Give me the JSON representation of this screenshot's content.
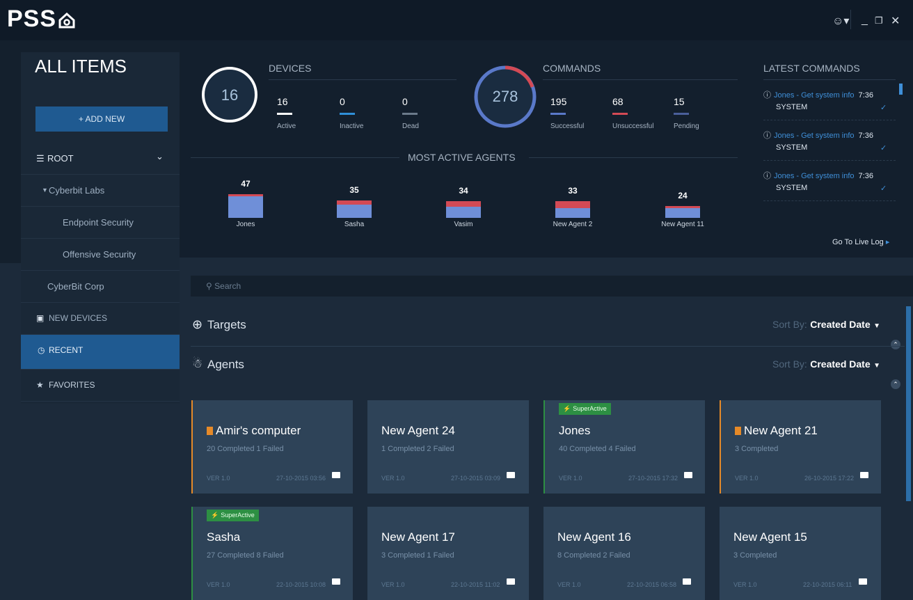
{
  "app": {
    "logo_text": "PSS"
  },
  "sidebar": {
    "title": "ALL ITEMS",
    "add_new": "+ ADD NEW",
    "root": "ROOT",
    "items": [
      {
        "label": "Cyberbit Labs"
      },
      {
        "label": "Endpoint Security"
      },
      {
        "label": "Offensive Security"
      },
      {
        "label": "CyberBit Corp"
      }
    ],
    "new_devices": "NEW DEVICES",
    "recent": "RECENT",
    "favorites": "FAVORITES"
  },
  "devices": {
    "title": "DEVICES",
    "total": "16",
    "stats": [
      {
        "value": "16",
        "label": "Active",
        "color": "#ffffff"
      },
      {
        "value": "0",
        "label": "Inactive",
        "color": "#2f8fd8"
      },
      {
        "value": "0",
        "label": "Dead",
        "color": "#6b7a8a"
      }
    ]
  },
  "commands": {
    "title": "COMMANDS",
    "total": "278",
    "stats": [
      {
        "value": "195",
        "label": "Successful",
        "color": "#5a79c9"
      },
      {
        "value": "68",
        "label": "Unsuccessful",
        "color": "#d34a55"
      },
      {
        "value": "15",
        "label": "Pending",
        "color": "#4a5f9a"
      }
    ]
  },
  "most_active": {
    "title": "MOST ACTIVE AGENTS",
    "agents": [
      {
        "name": "Jones",
        "count": "47",
        "count_n": 47,
        "failed": 4
      },
      {
        "name": "Sasha",
        "count": "35",
        "count_n": 35,
        "failed": 8
      },
      {
        "name": "Vasim",
        "count": "34",
        "count_n": 34,
        "failed": 12
      },
      {
        "name": "New Agent 2",
        "count": "33",
        "count_n": 33,
        "failed": 14
      },
      {
        "name": "New Agent 11",
        "count": "24",
        "count_n": 24,
        "failed": 3
      }
    ]
  },
  "latest_commands": {
    "title": "LATEST COMMANDS",
    "items": [
      {
        "text": "Jones - Get system info",
        "time": "7:36",
        "sub": "SYSTEM"
      },
      {
        "text": "Jones - Get system info",
        "time": "7:36",
        "sub": "SYSTEM"
      },
      {
        "text": "Jones - Get system info",
        "time": "7:36",
        "sub": "SYSTEM"
      }
    ],
    "go_live": "Go To Live Log"
  },
  "search": {
    "placeholder": "Search"
  },
  "sections": {
    "targets": {
      "title": "Targets",
      "sort_label": "Sort By:",
      "sort_value": "Created Date"
    },
    "agents": {
      "title": "Agents",
      "sort_label": "Sort By:",
      "sort_value": "Created Date"
    }
  },
  "cards": [
    {
      "name": "Amir's computer",
      "stat": "20 Completed 1 Failed",
      "ver": "VER 1.0",
      "date": "27-10-2015 03:56",
      "flag": true,
      "badge": ""
    },
    {
      "name": "New Agent 24",
      "stat": "1 Completed 2 Failed",
      "ver": "VER 1.0",
      "date": "27-10-2015 03:09",
      "flag": false,
      "badge": ""
    },
    {
      "name": "Jones",
      "stat": "40 Completed 4 Failed",
      "ver": "VER 1.0",
      "date": "27-10-2015 17:32",
      "flag": false,
      "badge": "SuperActive"
    },
    {
      "name": "New Agent 21",
      "stat": "3 Completed",
      "ver": "VER 1.0",
      "date": "26-10-2015 17:22",
      "flag": true,
      "badge": ""
    },
    {
      "name": "Sasha",
      "stat": "27 Completed 8 Failed",
      "ver": "VER 1.0",
      "date": "22-10-2015 10:08",
      "flag": false,
      "badge": "SuperActive"
    },
    {
      "name": "New Agent 17",
      "stat": "3 Completed 1 Failed",
      "ver": "VER 1.0",
      "date": "22-10-2015 11:02",
      "flag": false,
      "badge": ""
    },
    {
      "name": "New Agent 16",
      "stat": "8 Completed 2 Failed",
      "ver": "VER 1.0",
      "date": "22-10-2015 06:58",
      "flag": false,
      "badge": ""
    },
    {
      "name": "New Agent 15",
      "stat": "3 Completed",
      "ver": "VER 1.0",
      "date": "22-10-2015 06:11",
      "flag": false,
      "badge": ""
    }
  ],
  "colors": {
    "accent": "#1f5a91",
    "failed": "#d34a55",
    "success": "#6f8fd8",
    "superactive": "#2d8f43",
    "flag": "#e68a28"
  }
}
